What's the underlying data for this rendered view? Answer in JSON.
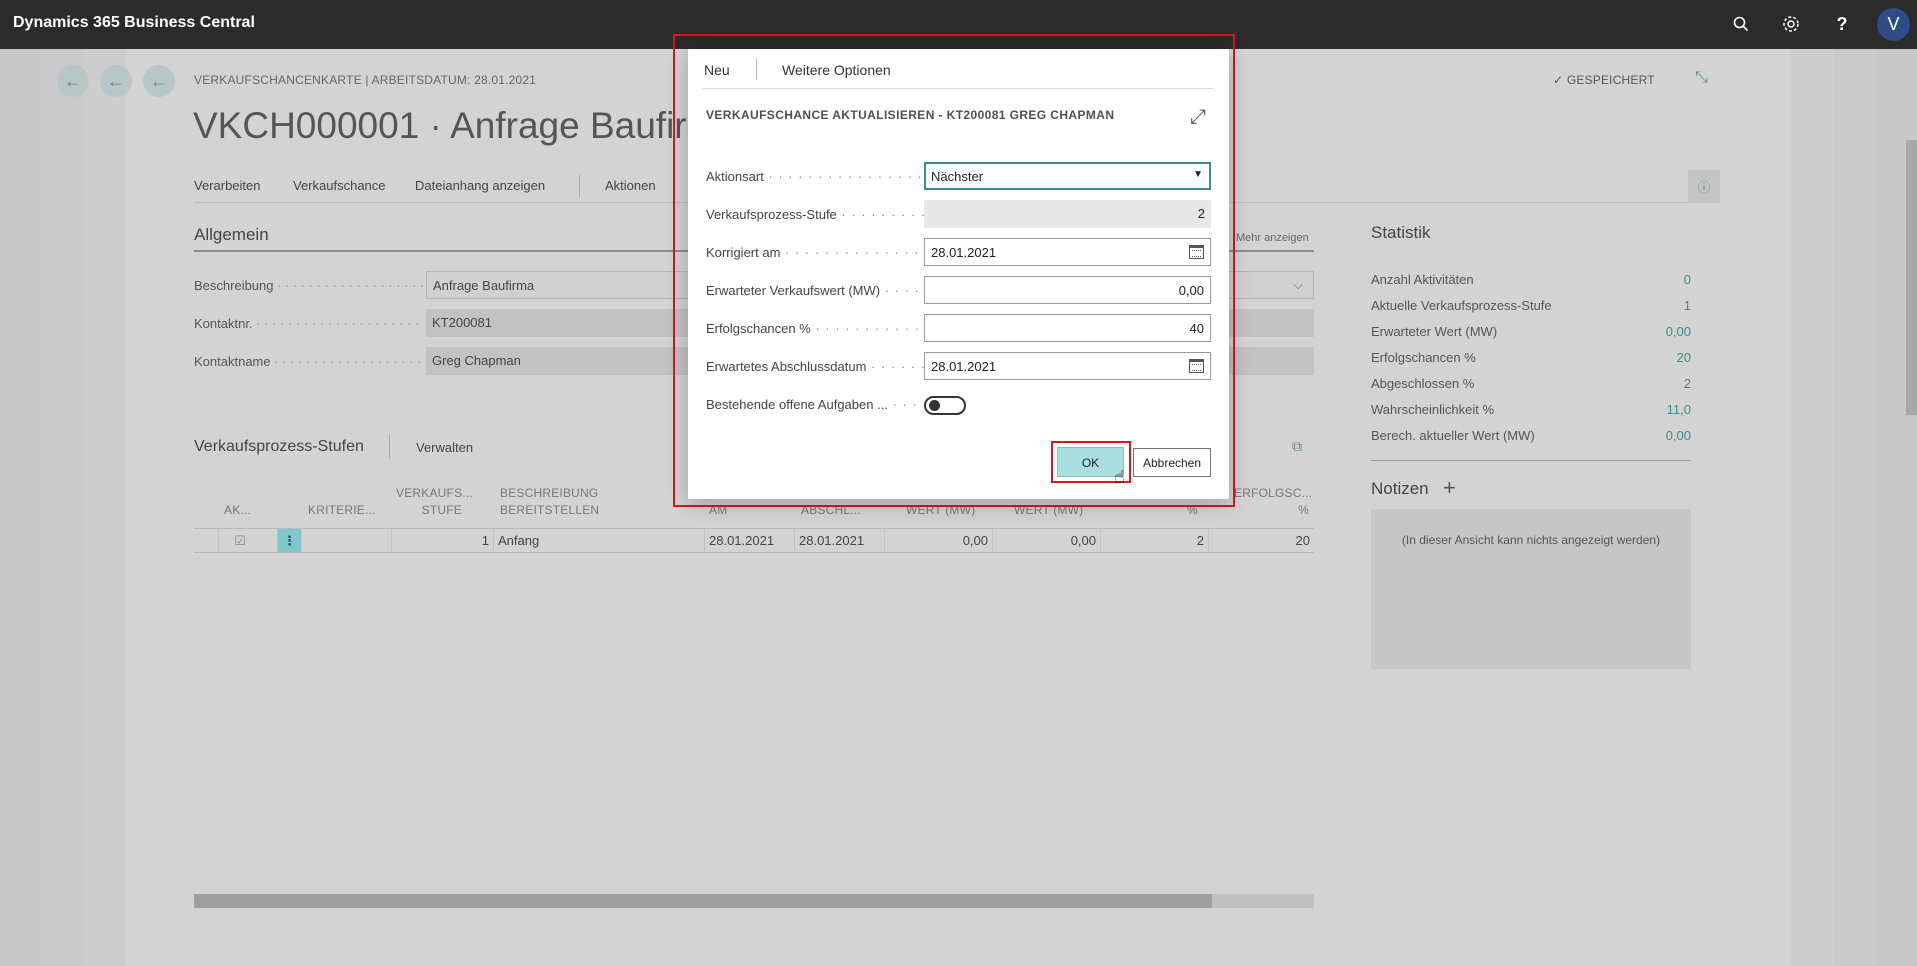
{
  "app": {
    "title": "Dynamics 365 Business Central",
    "avatar_letter": "V"
  },
  "header_icons": [
    "search-icon",
    "gear-icon",
    "help-icon"
  ],
  "page": {
    "breadcrumb": "VERKAUFSCHANCENKARTE | ARBEITSDATUM: 28.01.2021",
    "title": "VKCH000001 · Anfrage Baufirma",
    "saved_label": "GESPEICHERT",
    "actions": [
      "Verarbeiten",
      "Verkaufschance",
      "Dateianhang anzeigen",
      "Aktionen"
    ]
  },
  "general": {
    "heading": "Allgemein",
    "more_label": "Mehr anzeigen",
    "fields": [
      {
        "label": "Beschreibung",
        "value": "Anfrage Baufirma"
      },
      {
        "label": "Kontaktnr.",
        "value": "KT200081"
      },
      {
        "label": "Kontaktname",
        "value": "Greg Chapman"
      }
    ]
  },
  "statistics": {
    "heading": "Statistik",
    "rows": [
      {
        "label": "Anzahl Aktivitäten",
        "value": "0"
      },
      {
        "label": "Aktuelle Verkaufsprozess-Stufe",
        "value": "1"
      },
      {
        "label": "Erwarteter Wert (MW)",
        "value": "0,00"
      },
      {
        "label": "Erfolgschancen %",
        "value": "20"
      },
      {
        "label": "Abgeschlossen %",
        "value": "2"
      },
      {
        "label": "Wahrscheinlichkeit %",
        "value": "11,0"
      },
      {
        "label": "Berech. aktueller Wert (MW)",
        "value": "0,00"
      }
    ]
  },
  "notes": {
    "heading": "Notizen",
    "empty_text": "(In dieser Ansicht kann nichts angezeigt werden)"
  },
  "stages": {
    "heading": "Verkaufsprozess-Stufen",
    "manage_label": "Verwalten",
    "columns": {
      "active": "AK...",
      "criteria": "KRITERIE...",
      "stage_l1": "VERKAUFS...",
      "stage_l2": "STUFE",
      "desc_l1": "BESCHREIBUNG",
      "desc_l2": "BEREITSTELLEN",
      "date": "AM",
      "closing": "ABSCHL...",
      "value1": "WERT (MW)",
      "value2": "WERT (MW)",
      "percent1": "%",
      "success_l1": "ERFOLGSC...",
      "success_l2": "%"
    },
    "row": {
      "stage": "1",
      "description": "Anfang",
      "date": "28.01.2021",
      "closing_date": "28.01.2021",
      "value1": "0,00",
      "value2": "0,00",
      "percent": "2",
      "success": "20"
    }
  },
  "dialog": {
    "tabs": [
      "Neu",
      "Weitere Optionen"
    ],
    "title": "VERKAUFSCHANCE AKTUALISIEREN - KT200081 GREG CHAPMAN",
    "fields": {
      "action_type": {
        "label": "Aktionsart",
        "value": "Nächster"
      },
      "stage": {
        "label": "Verkaufsprozess-Stufe",
        "value": "2"
      },
      "corrected_on": {
        "label": "Korrigiert am",
        "value": "28.01.2021"
      },
      "expected_value": {
        "label": "Erwarteter Verkaufswert (MW)",
        "value": "0,00"
      },
      "chances": {
        "label": "Erfolgschancen %",
        "value": "40"
      },
      "closing_date": {
        "label": "Erwartetes Abschlussdatum",
        "value": "28.01.2021"
      },
      "open_tasks": {
        "label": "Bestehende offene Aufgaben ..."
      }
    },
    "ok_label": "OK",
    "cancel_label": "Abbrechen"
  }
}
